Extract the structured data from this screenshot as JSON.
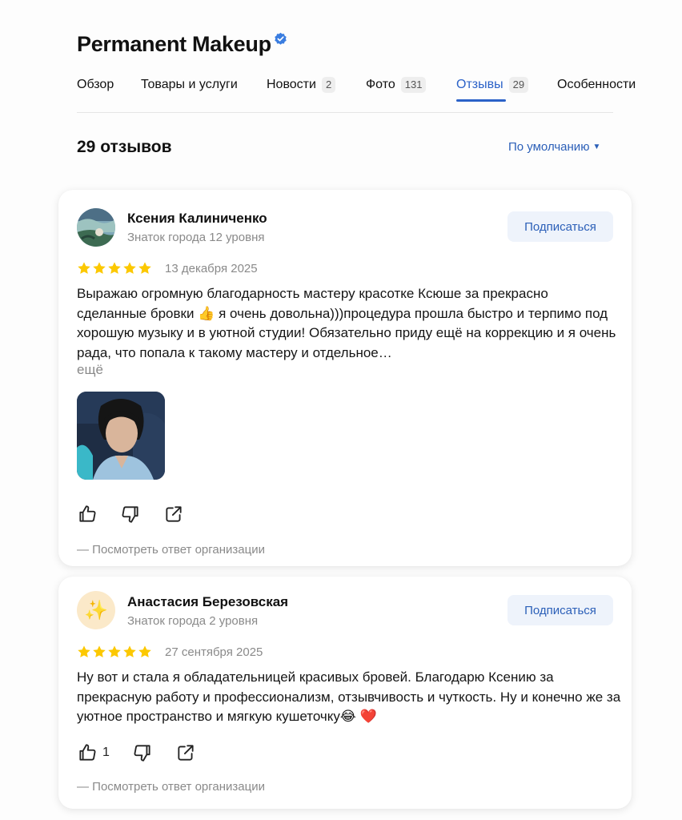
{
  "header": {
    "title": "Permanent Makeup"
  },
  "tabs": [
    {
      "label": "Обзор",
      "count": ""
    },
    {
      "label": "Товары и услуги",
      "count": ""
    },
    {
      "label": "Новости",
      "count": "2"
    },
    {
      "label": "Фото",
      "count": "131"
    },
    {
      "label": "Отзывы",
      "count": "29"
    },
    {
      "label": "Особенности",
      "count": ""
    }
  ],
  "reviews_header": {
    "count_label": "29 отзывов",
    "sort_label": "По умолчанию"
  },
  "reviews": [
    {
      "author": "Ксения Калиниченко",
      "level": "Знаток города 12 уровня",
      "subscribe_label": "Подписаться",
      "rating": 5,
      "date": "13 декабря 2025",
      "text": "Выражаю огромную благодарность мастеру красотке Ксюше за прекрасно сделанные бровки 👍 я очень довольна)))процедура прошла быстро и терпимо под хорошую музыку и в уютной студии! Обязательно приду ещё на коррекцию и я очень рада, что попала к такому мастеру и отдельное…",
      "more_label": "ещё",
      "likes": "",
      "reply_label": "— Посмотреть ответ организации"
    },
    {
      "author": "Анастасия Березовская",
      "level": "Знаток города 2 уровня",
      "subscribe_label": "Подписаться",
      "avatar_glyph": "✨",
      "rating": 5,
      "date": "27 сентября 2025",
      "text": "Ну вот и стала я обладательницей красивых бровей. Благодарю Ксению за прекрасную работу и профессионализм, отзывчивость и чуткость. Ну и конечно же за уютное пространство и мягкую кушеточку😂 ❤️",
      "likes": "1",
      "reply_label": "— Посмотреть ответ организации"
    }
  ],
  "colors": {
    "accent": "#2b62c8",
    "star": "#fcc800",
    "muted": "#8a8a8a",
    "button_bg": "#eef3fb"
  }
}
